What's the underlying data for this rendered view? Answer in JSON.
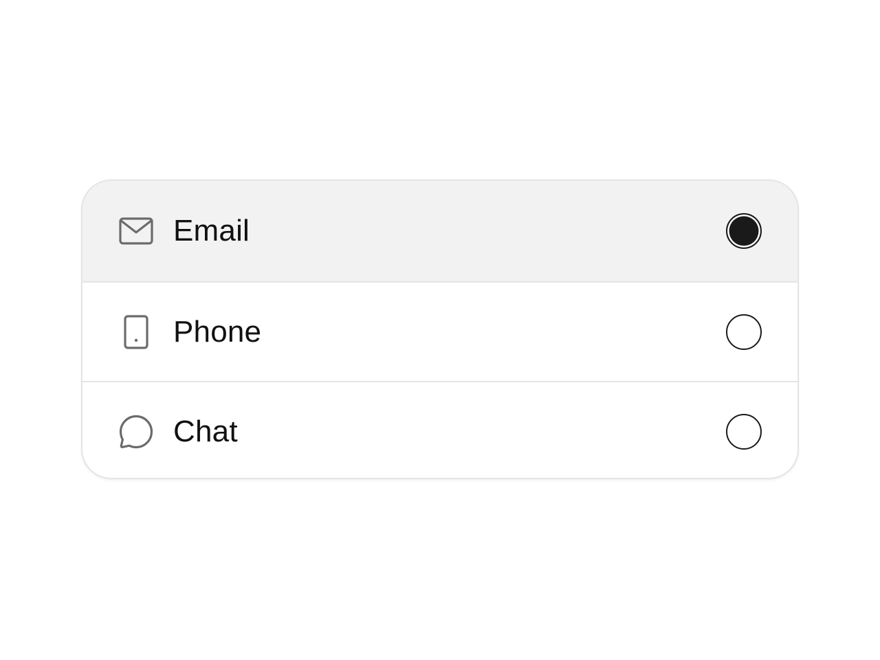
{
  "options": [
    {
      "label": "Email",
      "icon": "envelope-icon",
      "selected": true
    },
    {
      "label": "Phone",
      "icon": "phone-icon",
      "selected": false
    },
    {
      "label": "Chat",
      "icon": "chat-bubble-icon",
      "selected": false
    }
  ],
  "colors": {
    "selected_row_bg": "#f2f2f2",
    "border": "#e4e4e4",
    "radio": "#1a1a1a",
    "icon": "#6b6b6b",
    "text": "#111111"
  }
}
